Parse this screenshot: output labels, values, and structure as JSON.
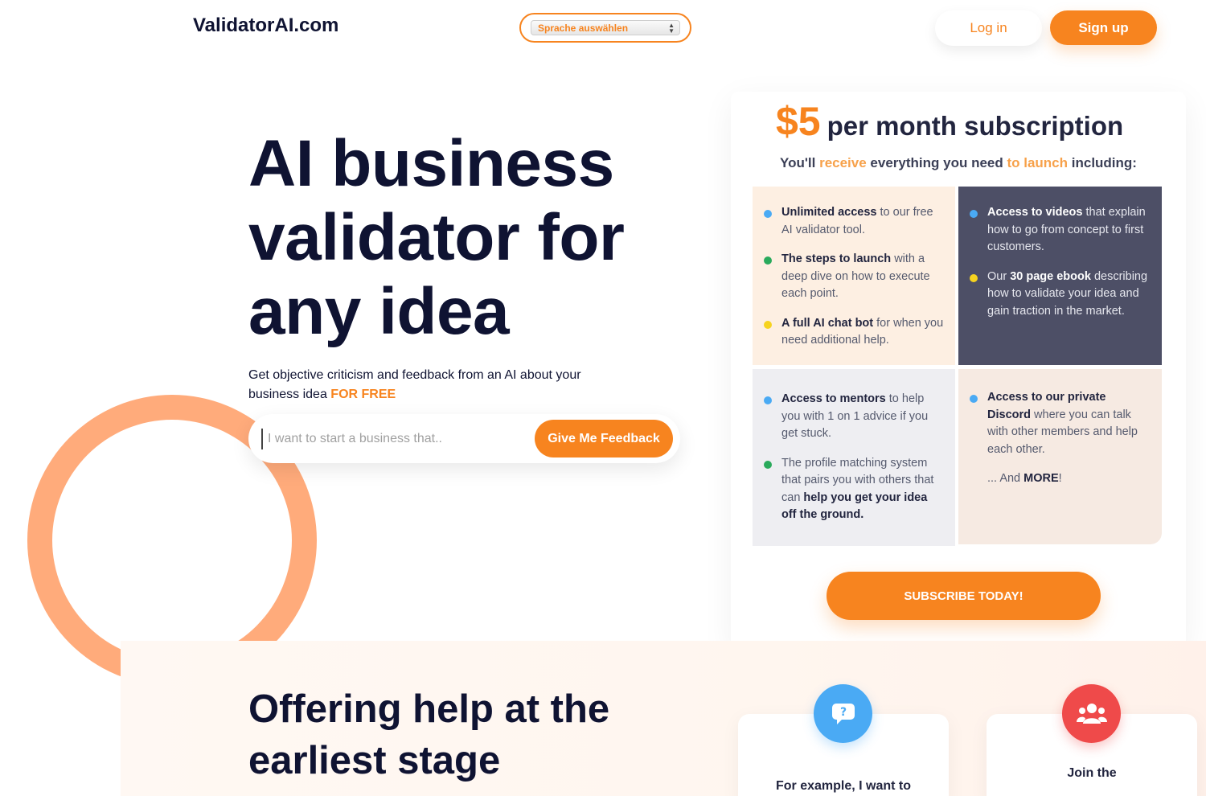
{
  "header": {
    "logo": "ValidatorAI.com",
    "language_select": "Sprache auswählen",
    "login_label": "Log in",
    "signup_label": "Sign up"
  },
  "hero": {
    "title": "AI business validator for any idea",
    "subtitle": "Get objective criticism and feedback from an AI about your business idea",
    "subtitle_highlight": "FOR FREE",
    "search_placeholder": "I want to start a business that..",
    "feedback_button": "Give Me Feedback"
  },
  "pricing": {
    "price": "$5",
    "per": "per month subscription",
    "receive": {
      "a": "You'll ",
      "b": "receive",
      "c": " everything you need ",
      "d": "to launch",
      "e": " including:"
    },
    "cells": {
      "c1": [
        {
          "bold": "Unlimited access",
          "text": " to our free AI validator tool."
        },
        {
          "bold": "The steps to launch",
          "text": " with a deep dive on how to execute each point."
        },
        {
          "bold": "A full AI chat bot",
          "text": " for when you need additional help."
        }
      ],
      "c2": [
        {
          "bold": "Access to videos",
          "text": " that explain how to go from concept to first customers."
        },
        {
          "pre": "Our ",
          "bold": "30 page ebook",
          "text": " describing how to validate your idea and gain traction in the market."
        }
      ],
      "c3": [
        {
          "bold": "Access to mentors",
          "text": " to help you with 1 on 1 advice if you get stuck."
        },
        {
          "text": "The profile matching system that pairs you with others that can ",
          "bold": "help you get your idea off the ground."
        }
      ],
      "c4": [
        {
          "bold": "Access to our private Discord",
          "text": " where you can talk with other members and help each other."
        }
      ],
      "more_pre": "... And ",
      "more_bold": "MORE",
      "more_post": "!"
    },
    "subscribe_button": "SUBSCRIBE TODAY!"
  },
  "lower": {
    "title": "Offering help at the earliest stage",
    "card1_text": "For example, I want to",
    "card2_text": "Join the",
    "icons": [
      "question-chat-icon",
      "community-icon"
    ]
  },
  "colors": {
    "accent": "#f7841f",
    "ring": "#ffab7b",
    "dark_cell": "#4d4f66"
  }
}
